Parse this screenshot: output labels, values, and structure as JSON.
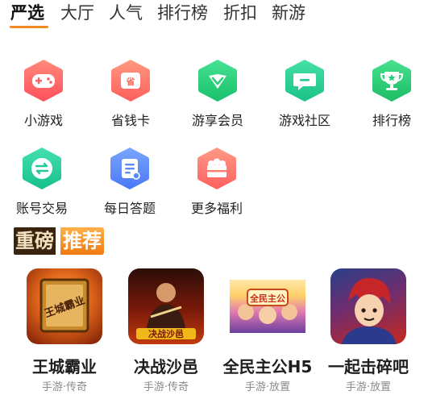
{
  "tabs": [
    {
      "label": "严选",
      "active": true
    },
    {
      "label": "大厅"
    },
    {
      "label": "人气"
    },
    {
      "label": "排行榜"
    },
    {
      "label": "折扣"
    },
    {
      "label": "新游"
    }
  ],
  "grid": [
    {
      "label": "小游戏",
      "icon": "gamepad-icon",
      "color": "#ff6a6a"
    },
    {
      "label": "省钱卡",
      "icon": "save-card-icon",
      "color": "#ff7b6b"
    },
    {
      "label": "游享会员",
      "icon": "vip-chevron-icon",
      "color": "#2ed17e"
    },
    {
      "label": "游戏社区",
      "icon": "chat-bubble-icon",
      "color": "#30d19a"
    },
    {
      "label": "排行榜",
      "icon": "trophy-icon",
      "color": "#2fcb7c"
    },
    {
      "label": "账号交易",
      "icon": "exchange-icon",
      "color": "#28cfa0"
    },
    {
      "label": "每日答题",
      "icon": "quiz-doc-icon",
      "color": "#5b8cff"
    },
    {
      "label": "更多福利",
      "icon": "gift-box-icon",
      "color": "#ff7e6e"
    }
  ],
  "recommend": {
    "title_left": "重磅",
    "title_right": "推荐"
  },
  "games": [
    {
      "name": "王城霸业",
      "tag": "手游·传奇",
      "cover_text": "王城霸业"
    },
    {
      "name": "决战沙邑",
      "tag": "手游·传奇",
      "cover_text": "决战沙邑"
    },
    {
      "name": "全民主公H5",
      "tag": "手游·放置",
      "cover_text": "全民主公"
    },
    {
      "name": "一起击碎吧",
      "tag": "手游·放置",
      "cover_text": ""
    }
  ]
}
